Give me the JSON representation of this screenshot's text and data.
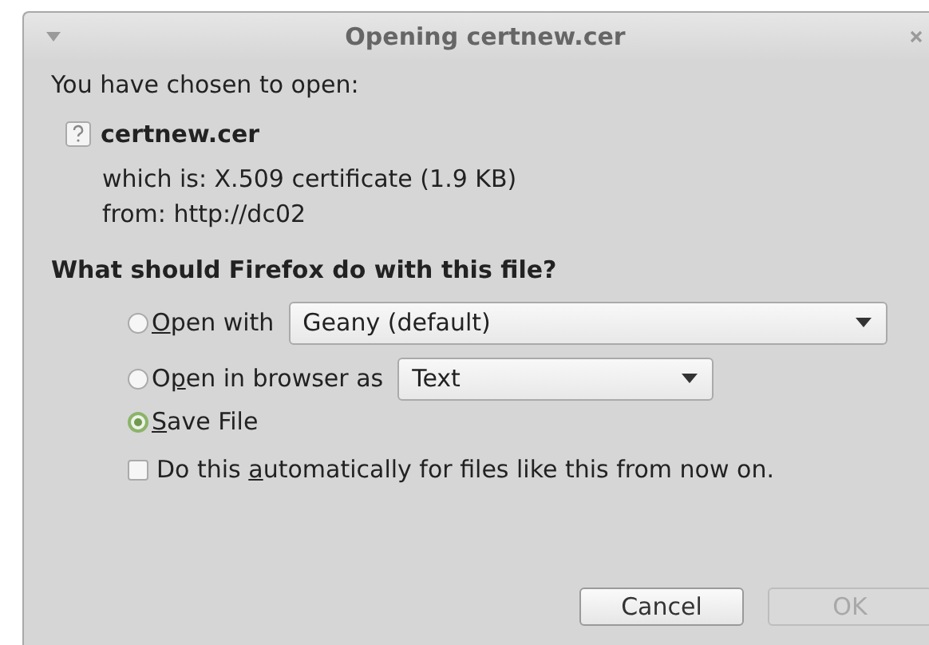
{
  "window": {
    "title": "Opening certnew.cer"
  },
  "intro": "You have chosen to open:",
  "file": {
    "name": "certnew.cer",
    "type_line": "which is: X.509 certificate (1.9 KB)",
    "from_line": "from: http://dc02"
  },
  "question": "What should Firefox do with this file?",
  "options": [
    {
      "kind": "dropdown",
      "mnemonic": "O",
      "after": "pen with",
      "selected": false,
      "value": "Geany (default)"
    },
    {
      "kind": "dropdown",
      "before": "O",
      "mnemonic": "p",
      "after": "en in browser as",
      "selected": false,
      "value": "Text"
    },
    {
      "kind": "plain",
      "mnemonic": "S",
      "after": "ave File",
      "selected": true
    }
  ],
  "auto": {
    "before": "Do this ",
    "mnemonic": "a",
    "after": "utomatically for files like this from now on.",
    "checked": false
  },
  "buttons": [
    {
      "label": "Cancel",
      "disabled": false
    },
    {
      "label": "OK",
      "disabled": true
    }
  ]
}
